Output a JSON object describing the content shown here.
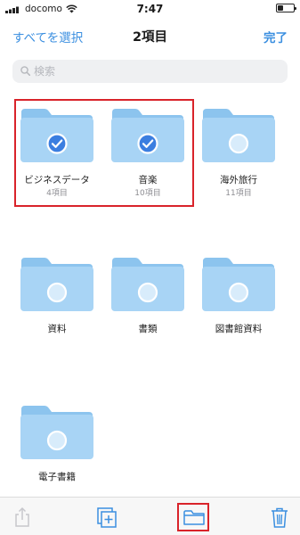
{
  "status_bar": {
    "carrier": "docomo",
    "time": "7:47"
  },
  "nav": {
    "left_label": "すべてを選択",
    "title": "2項目",
    "right_label": "完了"
  },
  "search": {
    "placeholder": "検索",
    "value": ""
  },
  "folders": [
    {
      "name": "ビジネスデータ",
      "count": "4項目",
      "selected": true
    },
    {
      "name": "音楽",
      "count": "10項目",
      "selected": true
    },
    {
      "name": "海外旅行",
      "count": "11項目",
      "selected": false
    },
    {
      "name": "資料",
      "count": "",
      "selected": false
    },
    {
      "name": "書類",
      "count": "",
      "selected": false
    },
    {
      "name": "図書館資料",
      "count": "",
      "selected": false
    },
    {
      "name": "電子書籍",
      "count": "",
      "selected": false
    }
  ],
  "toolbar": {
    "buttons": [
      "share-icon",
      "duplicate-icon",
      "move-to-folder-icon",
      "trash-icon"
    ]
  },
  "colors": {
    "accent": "#3b8fe0",
    "folder_body": "#a8d4f5",
    "folder_tab": "#8cc4ee",
    "check_fill": "#3b7ee0",
    "annotation_red": "#d9232a",
    "disabled_icon": "#c7c7cc"
  }
}
